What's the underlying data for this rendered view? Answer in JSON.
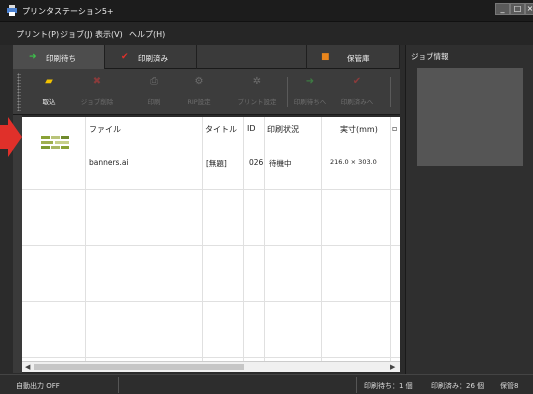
{
  "window": {
    "title": "プリンタステーション5+"
  },
  "menu": [
    "プリント(P)",
    "ジョブ(J)",
    "表示(V)",
    "ヘルプ(H)"
  ],
  "tabs": [
    {
      "label": "印刷待ち",
      "icon": "green-arrow-icon"
    },
    {
      "label": "印刷済み",
      "icon": "red-check-icon"
    },
    {
      "label": "保管庫",
      "icon": "orange-box-icon"
    }
  ],
  "toolbar": {
    "buttons": [
      {
        "label": "取込",
        "icon": "folder-icon",
        "enabled": true
      },
      {
        "label": "ジョブ削除",
        "icon": "red-x-icon",
        "enabled": false
      },
      {
        "label": "印刷",
        "icon": "printer-icon",
        "enabled": false
      },
      {
        "label": "RIP設定",
        "icon": "gears-icon",
        "enabled": false
      },
      {
        "label": "プリント設定",
        "icon": "gear-icon",
        "enabled": false
      },
      {
        "label": "印刷待ちへ",
        "icon": "green-arrow-icon",
        "enabled": false
      },
      {
        "label": "印刷済みへ",
        "icon": "red-check-icon",
        "enabled": false
      }
    ]
  },
  "table": {
    "headers": [
      "ファイル",
      "タイトル",
      "ID",
      "印刷状況",
      "実寸(mm)"
    ],
    "rows": [
      {
        "file": "banners.ai",
        "title": "[無題]",
        "id": "026",
        "status": "待機中",
        "size": "216.0 × 303.0"
      }
    ]
  },
  "job_panel": {
    "title": "ジョブ情報"
  },
  "status": {
    "auto_output": "自動出力 OFF",
    "waiting": "印刷待ち：1 個",
    "printed": "印刷済み：26 個",
    "storage": "保管8"
  },
  "colors": {
    "accent_green": "#3cc14a",
    "accent_red": "#e0302a",
    "accent_orange": "#e8851c"
  }
}
